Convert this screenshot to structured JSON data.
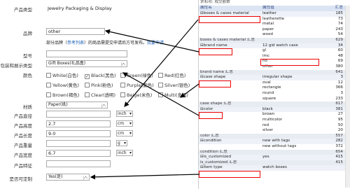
{
  "form": {
    "product_type": {
      "label": "产品类型",
      "value": "Jewelry Packaging & Display"
    },
    "brand": {
      "label": "品牌",
      "value": "other",
      "hint_prefix": "部分品牌（",
      "hint_link": "参考列表",
      "hint_middle": "）的商品需提交申请后方可发布。",
      "hint_link2": "我要申请"
    },
    "model": {
      "label": "型号",
      "value": ""
    },
    "display_type": {
      "label": "首饰包装和展示类型",
      "value": "Gift Boxes(礼品盒)"
    },
    "color": {
      "label": "颜色",
      "options": [
        {
          "text": "White(白色)",
          "checked": false
        },
        {
          "text": "Black(黑色)",
          "checked": true
        },
        {
          "text": "Green(绿色)",
          "checked": false
        },
        {
          "text": "Red(红色)",
          "checked": false
        },
        {
          "text": "Yellow(黄色)",
          "checked": false
        },
        {
          "text": "Pink(粉色)",
          "checked": false
        },
        {
          "text": "Purple(紫色)",
          "checked": false
        },
        {
          "text": "Silver(银色)",
          "checked": false
        },
        {
          "text": "Brown(褐色)",
          "checked": false
        },
        {
          "text": "Clear(透明)",
          "checked": false
        },
        {
          "text": "Beige(米色)",
          "checked": false
        },
        {
          "text": "Multi(多色)",
          "checked": false
        }
      ]
    },
    "material": {
      "label": "材质",
      "value": "Paper(纸)"
    },
    "diameter": {
      "label": "产品直径",
      "value": "",
      "unit": "inch"
    },
    "height": {
      "label": "产品高度",
      "value": "2.7",
      "unit": "cm"
    },
    "length": {
      "label": "产品长度",
      "value": "9.0",
      "unit": "cm"
    },
    "weight": {
      "label": "产品重量",
      "value": "",
      "unit": "g"
    },
    "width": {
      "label": "产品宽度",
      "value": "6.7",
      "unit": "inch"
    },
    "feature": {
      "label": "产品特征",
      "value": ""
    },
    "customized": {
      "label": "是否可定制",
      "value": "Yes(是)"
    }
  },
  "pivot": {
    "title": "求和项: 成交额数",
    "header": {
      "c1": "属性名",
      "c2": "属性值",
      "c3": "汇总"
    },
    "rows": [
      {
        "c1": "⊟boxes & cases material",
        "c2": "leather",
        "c3": "185",
        "kind": "grp"
      },
      {
        "c1": "",
        "c2": "leatherette",
        "c3": "73",
        "kind": ""
      },
      {
        "c1": "",
        "c2": "metal",
        "c3": "74",
        "kind": ""
      },
      {
        "c1": "",
        "c2": "paper",
        "c3": "243",
        "kind": ""
      },
      {
        "c1": "",
        "c2": "wood",
        "c3": "54",
        "kind": ""
      },
      {
        "c1": "boxes & cases material 汇总",
        "c2": "",
        "c3": "629",
        "kind": "tot"
      },
      {
        "c1": "⊟brand name",
        "c2": "12 gid watch case",
        "c3": "34",
        "kind": "grp"
      },
      {
        "c1": "",
        "c2": "gl",
        "c3": "60",
        "kind": ""
      },
      {
        "c1": "",
        "c2": "imc",
        "c3": "48",
        "kind": ""
      },
      {
        "c1": "",
        "c2": "no",
        "c3": "69",
        "kind": ""
      },
      {
        "c1": "",
        "c2": "other",
        "c3": "380",
        "kind": ""
      },
      {
        "c1": "brand name 汇总",
        "c2": "",
        "c3": "641",
        "kind": "tot"
      },
      {
        "c1": "⊟case shape",
        "c2": "irregular shape",
        "c3": "3",
        "kind": "grp"
      },
      {
        "c1": "",
        "c2": "oval",
        "c3": "12",
        "kind": ""
      },
      {
        "c1": "",
        "c2": "rectangle",
        "c3": "366",
        "kind": ""
      },
      {
        "c1": "",
        "c2": "round",
        "c3": "3",
        "kind": ""
      },
      {
        "c1": "",
        "c2": "square",
        "c3": "233",
        "kind": ""
      },
      {
        "c1": "case shape 汇总",
        "c2": "",
        "c3": "617",
        "kind": "tot"
      },
      {
        "c1": "⊟color",
        "c2": "black",
        "c3": "381",
        "kind": "grp"
      },
      {
        "c1": "",
        "c2": "brown",
        "c3": "27",
        "kind": ""
      },
      {
        "c1": "",
        "c2": "multicolor",
        "c3": "95",
        "kind": ""
      },
      {
        "c1": "",
        "c2": "red",
        "c3": "50",
        "kind": ""
      },
      {
        "c1": "",
        "c2": "silver",
        "c3": "20",
        "kind": ""
      },
      {
        "c1": "color 汇总",
        "c2": "",
        "c3": "557",
        "kind": "tot"
      },
      {
        "c1": "⊟condition",
        "c2": "new with tags",
        "c3": "282",
        "kind": "grp"
      },
      {
        "c1": "",
        "c2": "new without tags",
        "c3": "372",
        "kind": ""
      },
      {
        "c1": "condition 汇总",
        "c2": "",
        "c3": "654",
        "kind": "tot"
      },
      {
        "c1": "⊟is_customized",
        "c2": "yes",
        "c3": "415",
        "kind": "grp"
      },
      {
        "c1": "is_customized 汇总",
        "c2": "",
        "c3": "415",
        "kind": "tot"
      },
      {
        "c1": "⊟item type",
        "c2": "watch boxes",
        "c3": "",
        "kind": "grp"
      }
    ]
  },
  "colors": {
    "accent_red": "#e00000",
    "link": "#1a5fb4",
    "header_bg": "#dbe4f3"
  },
  "icons": [
    "checkbox-icon",
    "dropdown-arrow-icon",
    "expand-icon",
    "arrow-annotation"
  ]
}
